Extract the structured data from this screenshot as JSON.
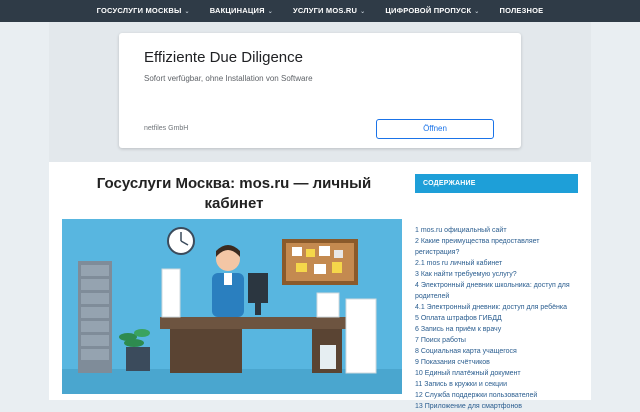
{
  "nav": {
    "items": [
      {
        "label": "ГОСУСЛУГИ МОСКВЫ",
        "has_dropdown": true
      },
      {
        "label": "ВАКЦИНАЦИЯ",
        "has_dropdown": true
      },
      {
        "label": "УСЛУГИ MOS.RU",
        "has_dropdown": true
      },
      {
        "label": "ЦИФРОВОЙ ПРОПУСК",
        "has_dropdown": true
      },
      {
        "label": "ПОЛЕЗНОЕ",
        "has_dropdown": false
      }
    ],
    "dropdown_glyph": "⌄"
  },
  "ad": {
    "title": "Effiziente Due Diligence",
    "subtitle": "Sofort verfügbar, ohne Installation von Software",
    "advertiser": "netfiles GmbH",
    "button_label": "Öffnen"
  },
  "article": {
    "title_line1": "Госуслуги Москва: mos.ru — личный",
    "title_line2": "кабинет"
  },
  "toc": {
    "header": "СОДЕРЖАНИЕ",
    "items": [
      "1 mos.ru официальный сайт",
      "2 Какие преимущества предоставляет регистрация?",
      "2.1 mos ru личный кабинет",
      "3 Как найти требуемую услугу?",
      "4 Электронный дневник школьника: доступ для родителей",
      "4.1 Электронный дневник: доступ для ребёнка",
      "5 Оплата штрафов ГИБДД",
      "6 Запись на приём к врачу",
      "7 Поиск работы",
      "8 Социальная карта учащегося",
      "9 Показания счётчиков",
      "10 Единый платёжный документ",
      "11 Запись в кружки и секции",
      "12 Служба поддержки пользователей",
      "13 Приложение для смартфонов"
    ]
  },
  "colors": {
    "nav_bg": "#2f3b47",
    "toc_header_bg": "#1e9fd8",
    "link": "#2a5d8f",
    "ad_button": "#1a73e8"
  }
}
